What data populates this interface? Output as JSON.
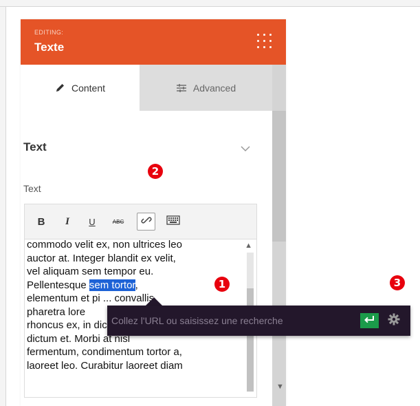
{
  "panel": {
    "editing_label": "EDITING:",
    "title": "Texte",
    "grid_icon": "grid-dots-icon",
    "accent_color": "#e55427"
  },
  "tabs": [
    {
      "label": "Content",
      "icon": "pencil-icon",
      "active": true
    },
    {
      "label": "Advanced",
      "icon": "sliders-icon",
      "active": false
    }
  ],
  "section": {
    "title": "Text",
    "chevron": "chevron-down-icon"
  },
  "field": {
    "label": "Text"
  },
  "toolbar": {
    "bold": "B",
    "italic": "I",
    "underline": "U",
    "strikethrough": "ABC",
    "link_icon": "link-icon",
    "kitchen_sink_icon": "keyboard-icon"
  },
  "editor": {
    "text_before": "commodo velit ex, non ultrices leo\nauctor at. Integer blandit ex velit,\nvel aliquam sem tempor eu.\nPellentesque ",
    "selected_text": "sem tortor",
    "text_after": ",\nelementum et pi ... convallis\npharetra lore\nrhoncus ex, in dictum massa\ndictum et. Morbi at nisl\nfermentum, condimentum tortor a,\nlaoreet leo. Curabitur laoreet diam"
  },
  "link_popup": {
    "placeholder": "Collez l'URL ou saisissez une recherche",
    "submit_icon": "enter-return-icon",
    "settings_icon": "gear-icon",
    "submit_color": "#1b9b4a"
  },
  "markers": [
    "1",
    "2",
    "3"
  ]
}
